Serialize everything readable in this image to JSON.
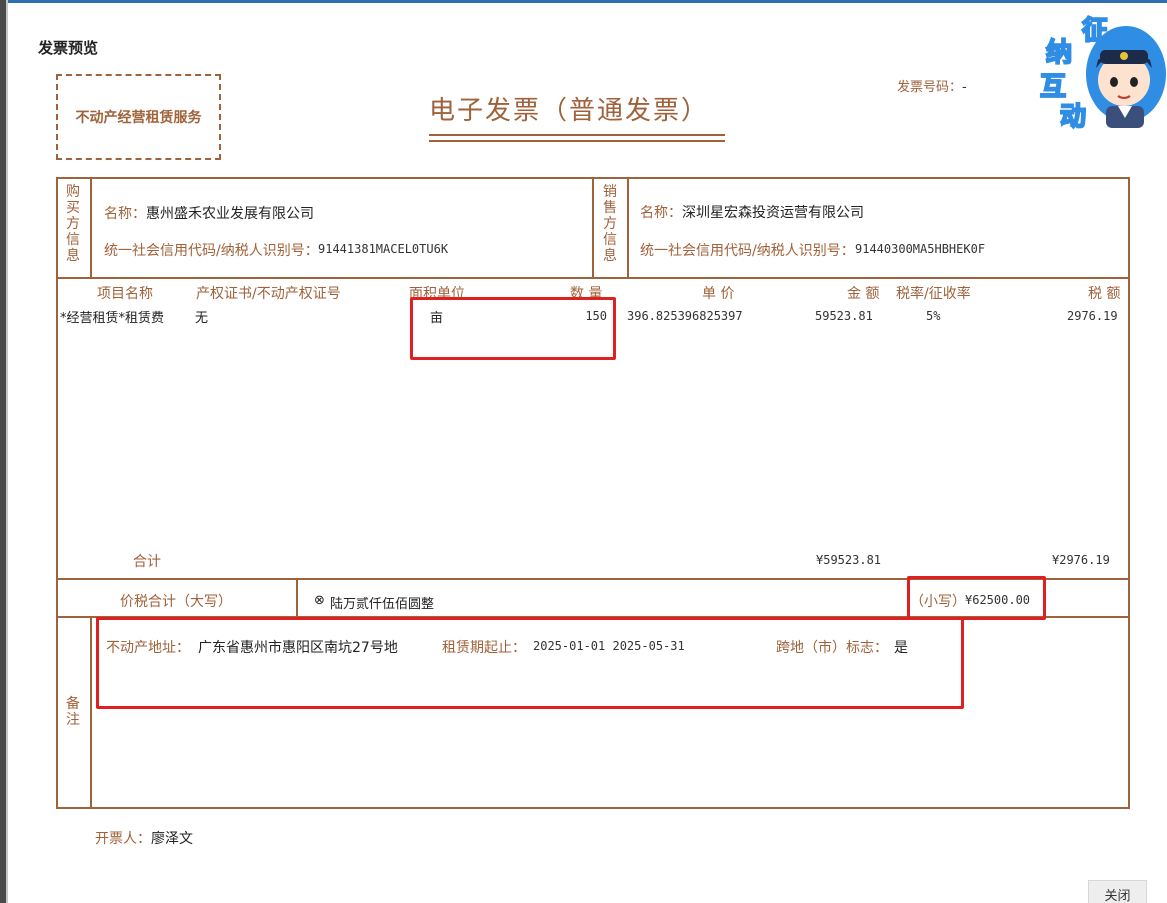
{
  "dialog": {
    "title": "发票预览",
    "close_label": "关闭"
  },
  "invoice": {
    "type_stamp": "不动产经营租赁服务",
    "title": "电子发票（普通发票）",
    "number_label": "发票号码：",
    "number_value": "-",
    "buyer": {
      "side_label": [
        "购",
        "买",
        "方",
        "信",
        "息"
      ],
      "name_label": "名称：",
      "name": "惠州盛禾农业发展有限公司",
      "tax_label": "统一社会信用代码/纳税人识别号：",
      "tax_id": "91441381MACEL0TU6K"
    },
    "seller": {
      "side_label": [
        "销",
        "售",
        "方",
        "信",
        "息"
      ],
      "name_label": "名称：",
      "name": "深圳星宏森投资运营有限公司",
      "tax_label": "统一社会信用代码/纳税人识别号：",
      "tax_id": "91440300MA5HBHEK0F"
    },
    "columns": {
      "item": "项目名称",
      "cert": "产权证书/不动产权证号",
      "area_unit": "面积单位",
      "qty": "数 量",
      "price": "单 价",
      "amount": "金 额",
      "rate": "税率/征收率",
      "tax": "税 额"
    },
    "items": [
      {
        "name": "*经营租赁*租赁费",
        "cert": "无",
        "unit": "亩",
        "qty": "150",
        "price": "396.825396825397",
        "amount": "59523.81",
        "rate": "5%",
        "tax": "2976.19"
      }
    ],
    "totals": {
      "label": "合计",
      "amount": "¥59523.81",
      "tax": "¥2976.19"
    },
    "grand_total": {
      "label": "价税合计（大写）",
      "words_icon": "⊗",
      "words": "陆万贰仟伍佰圆整",
      "small_label": "（小写）",
      "small_value": "¥62500.00"
    },
    "remarks": {
      "side_label": [
        "备",
        "注"
      ],
      "address_label": "不动产地址：",
      "address": "广东省惠州市惠阳区南坑27号地",
      "period_label": "租赁期起止：",
      "period": "2025-01-01 2025-05-31",
      "cross_label": "跨地（市）标志：",
      "cross": "是"
    },
    "issuer_label": "开票人：",
    "issuer": "廖泽文"
  },
  "badge": {
    "chars": [
      "征",
      "纳",
      "互",
      "动"
    ],
    "icon": "officer-avatar-icon"
  },
  "colors": {
    "accent": "#a0623a",
    "highlight": "#e02020",
    "badge_blue": "#2f8de4"
  }
}
